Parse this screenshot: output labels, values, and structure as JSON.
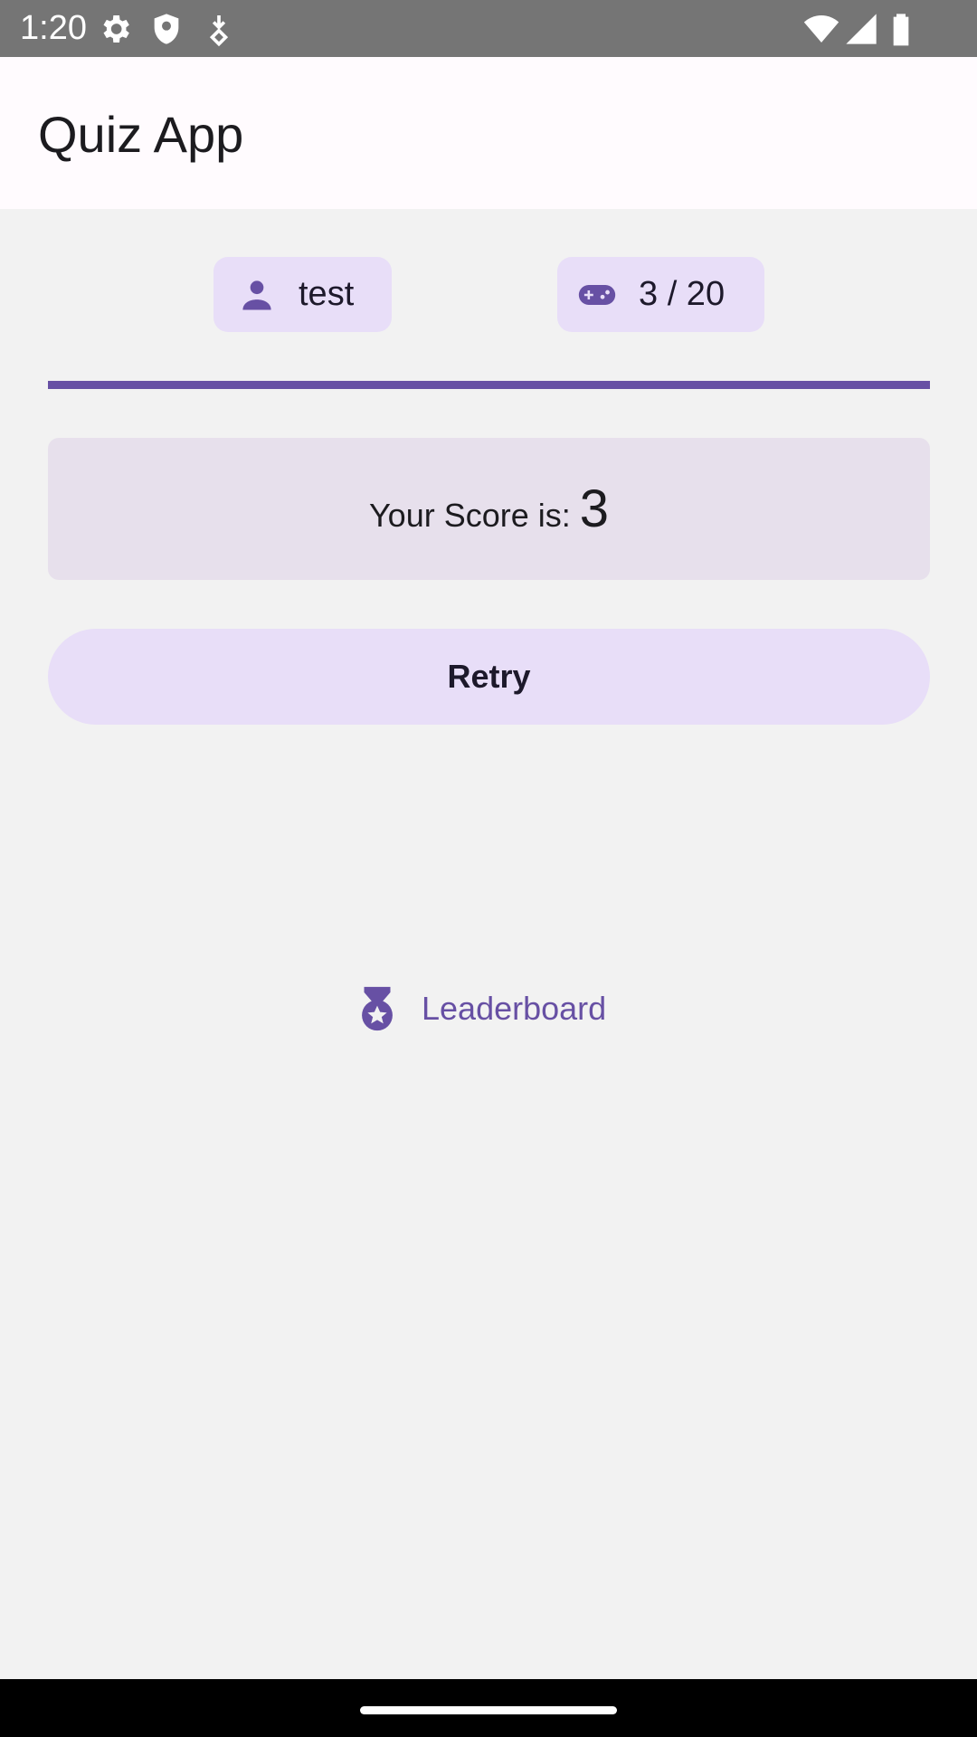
{
  "status_bar": {
    "time": "1:20",
    "icons": [
      "settings-icon",
      "shield-icon",
      "download-icon",
      "wifi-icon",
      "signal-icon",
      "battery-icon"
    ]
  },
  "app_bar": {
    "title": "Quiz App"
  },
  "chips": {
    "user": {
      "icon": "person-icon",
      "label": "test"
    },
    "score": {
      "icon": "gamepad-icon",
      "label": "3 / 20"
    }
  },
  "progress": {
    "value": 1.0
  },
  "score_card": {
    "label": "Your Score is:",
    "value": "3"
  },
  "retry_button": {
    "label": "Retry"
  },
  "leaderboard": {
    "icon": "medal-icon",
    "label": "Leaderboard"
  },
  "colors": {
    "primary": "#6750a4",
    "chip_bg": "#e8def8",
    "card_bg": "#e7e0ec",
    "background": "#f2f2f2",
    "app_bar_bg": "#fffbfe"
  }
}
